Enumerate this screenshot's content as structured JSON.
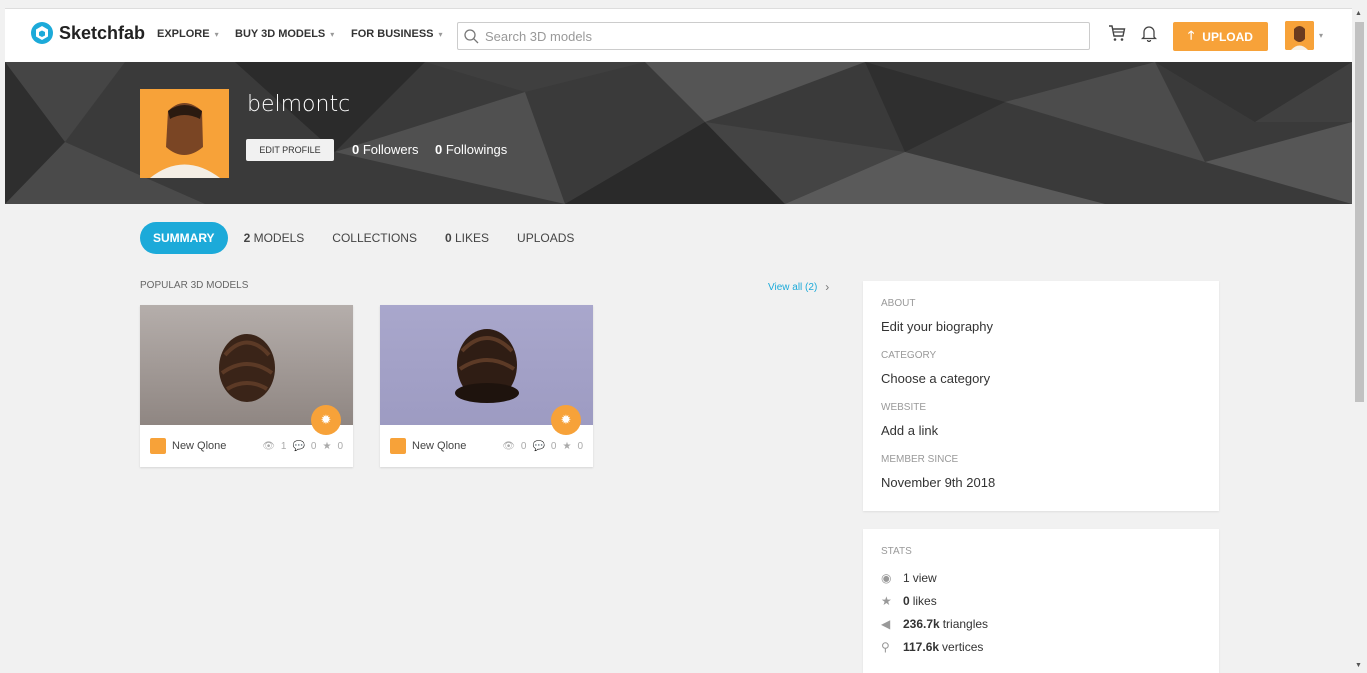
{
  "header": {
    "brand": "Sketchfab",
    "nav": [
      {
        "label": "EXPLORE"
      },
      {
        "label": "BUY 3D MODELS"
      },
      {
        "label": "FOR BUSINESS"
      }
    ],
    "search_placeholder": "Search 3D models",
    "upload_label": "UPLOAD"
  },
  "profile": {
    "username": "belmontc",
    "edit_label": "EDIT PROFILE",
    "followers_count": "0",
    "followers_label": "Followers",
    "followings_count": "0",
    "followings_label": "Followings"
  },
  "tabs": [
    {
      "label": "SUMMARY",
      "active": true
    },
    {
      "count": "2",
      "label": "MODELS"
    },
    {
      "label": "COLLECTIONS"
    },
    {
      "count": "0",
      "label": "LIKES"
    },
    {
      "label": "UPLOADS"
    }
  ],
  "popular": {
    "title": "POPULAR 3D MODELS",
    "view_all": "View all (2)",
    "models": [
      {
        "author": "New Qlone",
        "views": "1",
        "comments": "0",
        "likes": "0",
        "bg": "#a8a29e"
      },
      {
        "author": "New Qlone",
        "views": "0",
        "comments": "0",
        "likes": "0",
        "bg": "#a8a6c9"
      }
    ]
  },
  "about": {
    "about_title": "ABOUT",
    "about_value": "Edit your biography",
    "category_title": "CATEGORY",
    "category_value": "Choose a category",
    "website_title": "WEBSITE",
    "website_value": "Add a link",
    "member_title": "MEMBER SINCE",
    "member_value": "November 9th 2018"
  },
  "stats": {
    "title": "STATS",
    "views": "1",
    "views_label": "view",
    "likes": "0",
    "likes_label": "likes",
    "triangles": "236.7k",
    "triangles_label": "triangles",
    "vertices": "117.6k",
    "vertices_label": "vertices"
  },
  "colors": {
    "accent": "#1caad9",
    "orange": "#f7a239"
  }
}
